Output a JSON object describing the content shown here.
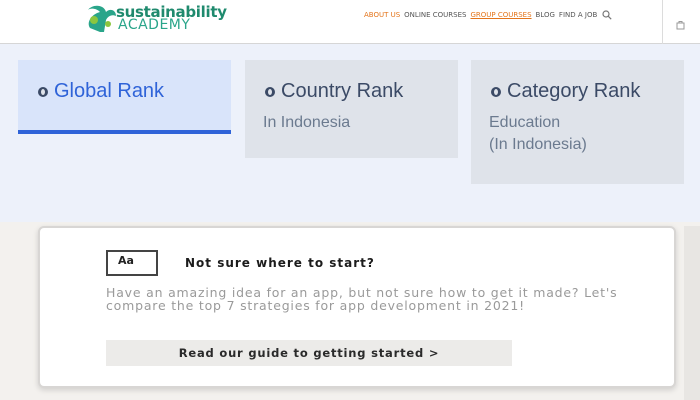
{
  "header": {
    "logo_line1": "sustainability",
    "logo_line2": "ACADEMY",
    "nav": [
      {
        "label": "ABOUT US",
        "style": "orange"
      },
      {
        "label": "ONLINE COURSES",
        "style": "plain"
      },
      {
        "label": "GROUP COURSES",
        "style": "orange-underline"
      },
      {
        "label": "BLOG",
        "style": "plain"
      },
      {
        "label": "FIND A JOB",
        "style": "plain"
      }
    ],
    "icons": [
      "search-icon",
      "cart-icon"
    ]
  },
  "ranks": [
    {
      "title": "Global Rank",
      "sub1": "",
      "sub2": "",
      "active": true
    },
    {
      "title": "Country Rank",
      "sub1": "In Indonesia",
      "sub2": "",
      "active": false
    },
    {
      "title": "Category Rank",
      "sub1": "Education",
      "sub2": "(In Indonesia)",
      "active": false
    }
  ],
  "promo": {
    "icon_text": "Aa",
    "title": "Not sure where to start?",
    "body": "Have an amazing idea for an app, but not sure how to get it made? Let's compare the top 7 strategies for app development in 2021!",
    "button": "Read our guide to getting started >"
  },
  "colors": {
    "brand_green": "#1f8a6e",
    "nav_orange": "#e4751b",
    "active_blue": "#2f63d8"
  }
}
